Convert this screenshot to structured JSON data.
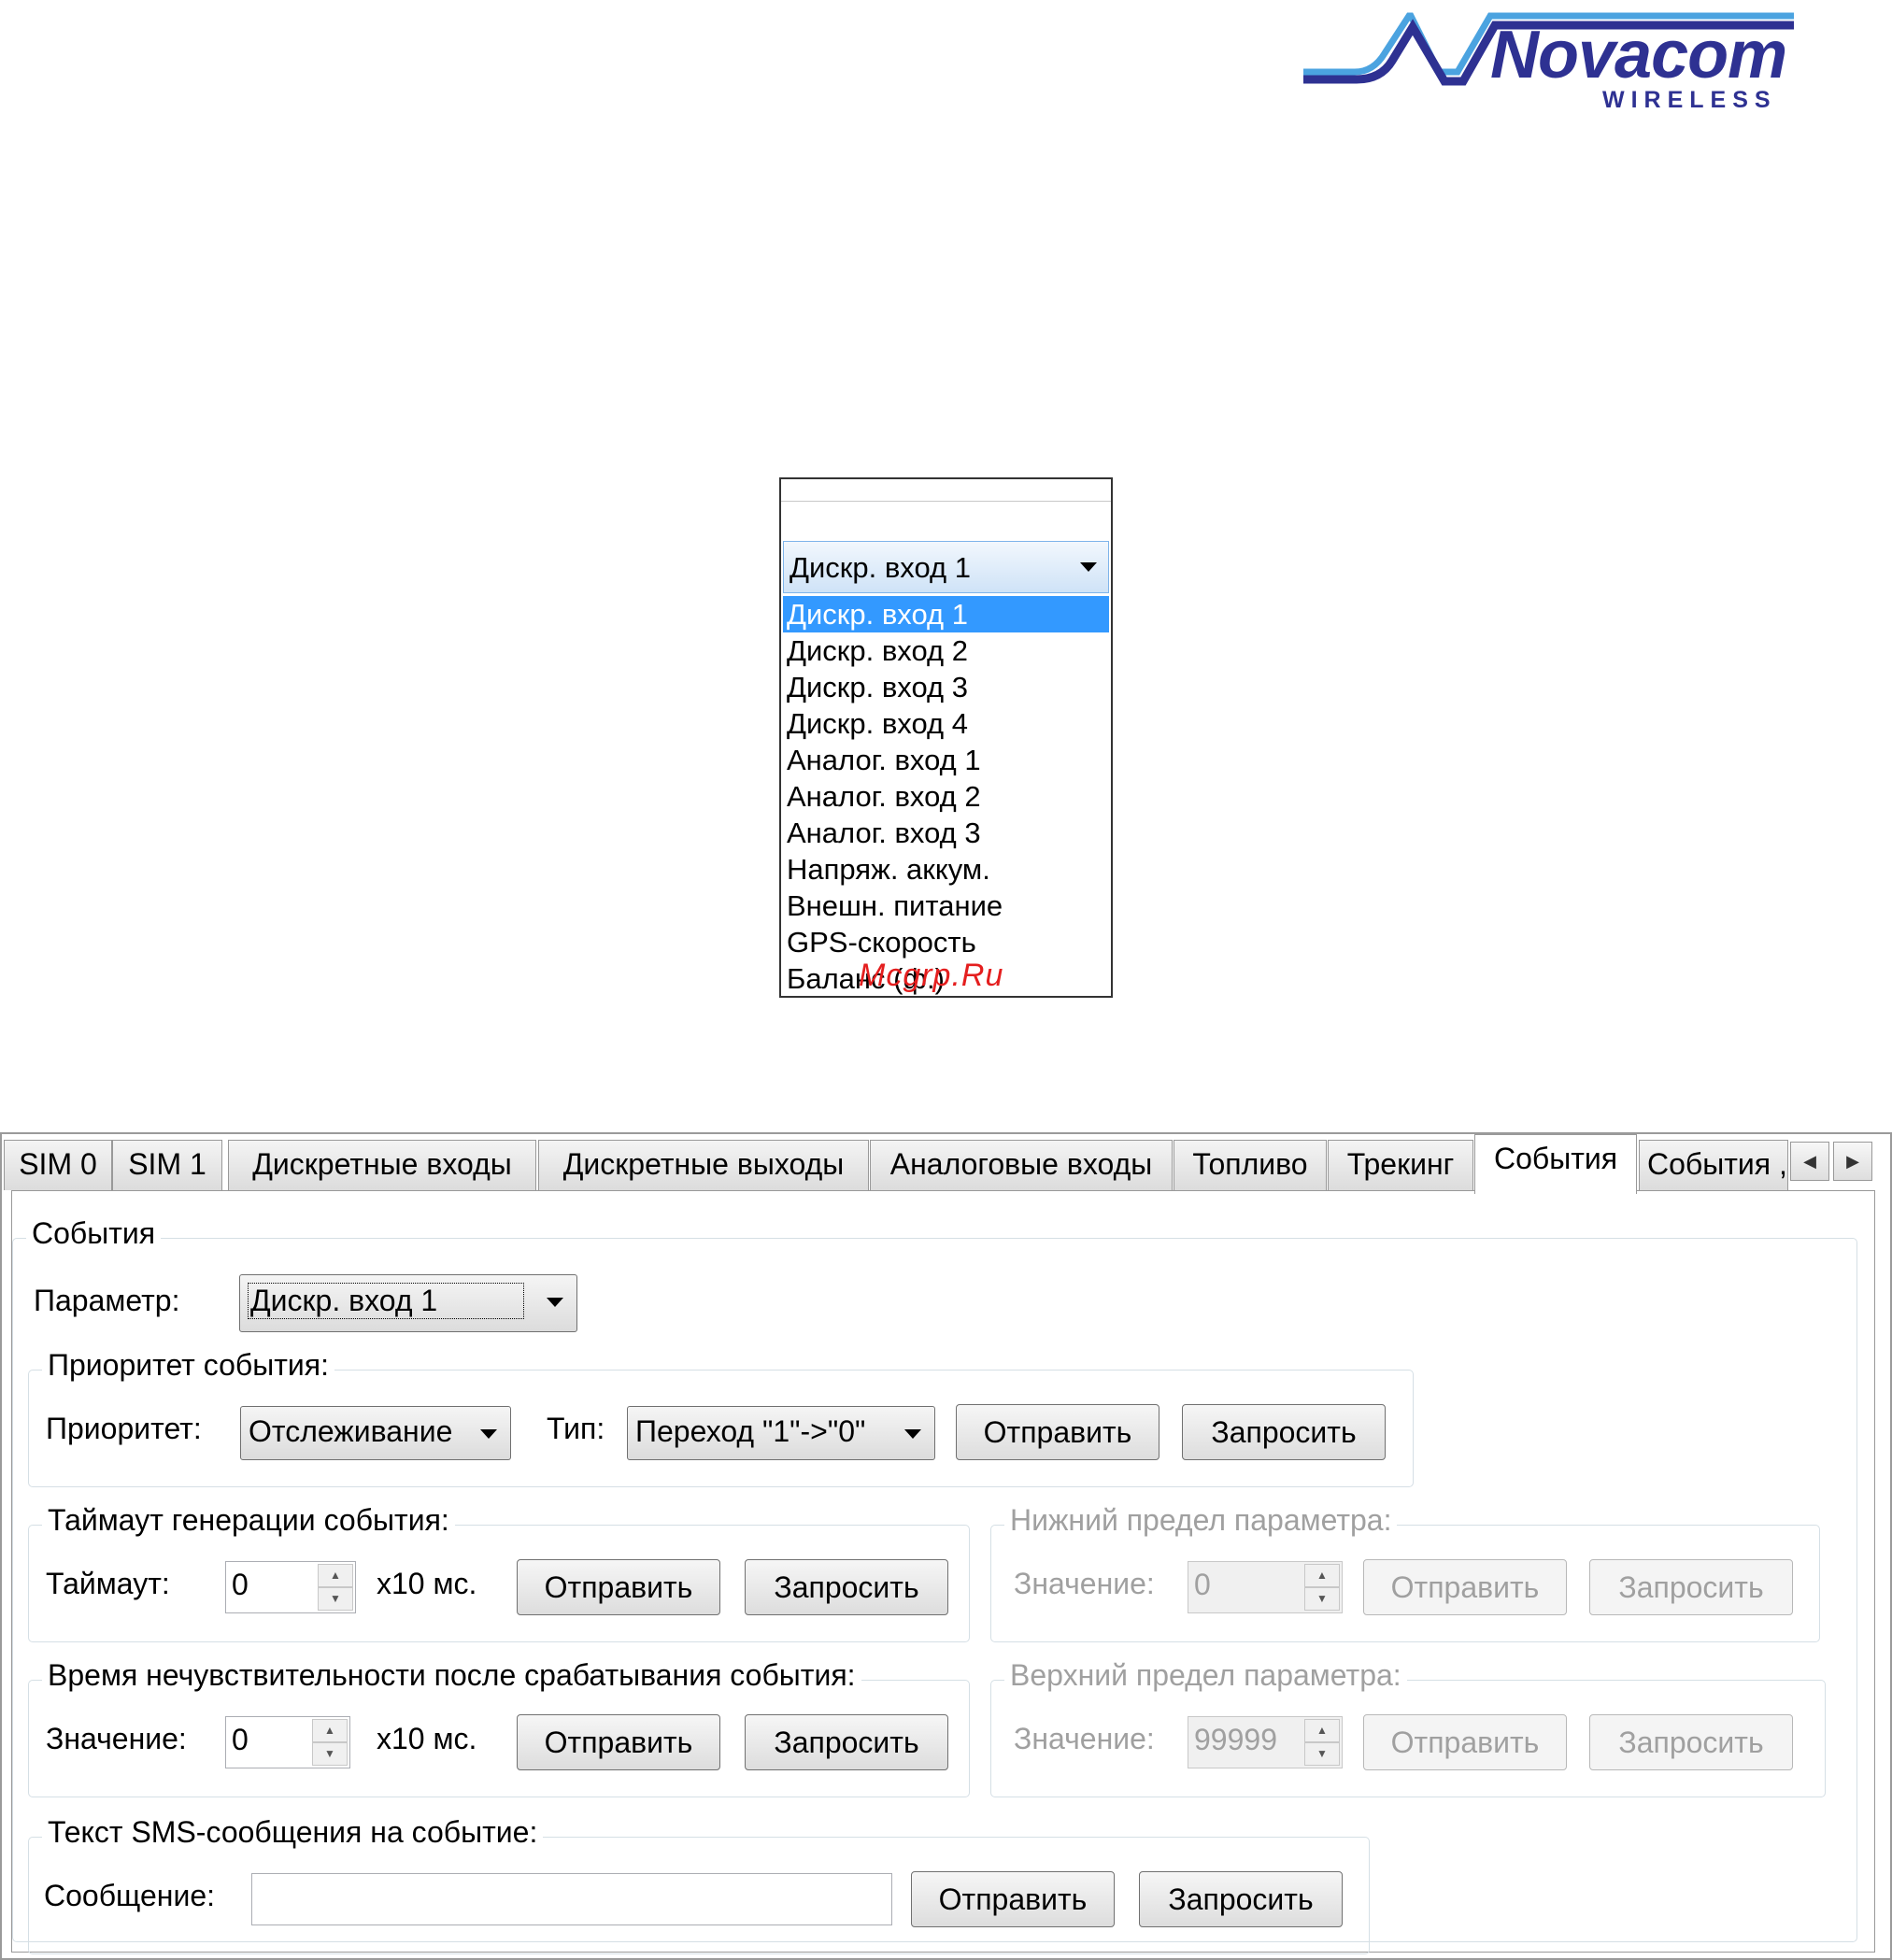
{
  "logo": {
    "name": "Novacom",
    "sub": "WIRELESS",
    "colors": {
      "brand": "#2e3192",
      "accent": "#4ba3e0"
    }
  },
  "dropdown_demo": {
    "selected": "Дискр. вход 1",
    "items": [
      "Дискр. вход 1",
      "Дискр. вход 2",
      "Дискр. вход 3",
      "Дискр. вход 4",
      "Аналог. вход 1",
      "Аналог. вход 2",
      "Аналог. вход 3",
      "Напряж. аккум.",
      "Внешн. питание",
      "GPS-скорость",
      "Баланс (ф.)"
    ],
    "highlight_color": "#3399ff"
  },
  "watermark": "Mcgrp.Ru",
  "tabs": [
    "SIM 0",
    "SIM 1",
    "Дискретные входы",
    "Дискретные выходы",
    "Аналоговые входы",
    "Топливо",
    "Трекинг",
    "События",
    "События ,"
  ],
  "active_tab": "События",
  "events": {
    "group_title": "События",
    "param_label": "Параметр:",
    "param_value": "Дискр. вход 1",
    "priority": {
      "title": "Приоритет события:",
      "priority_label": "Приоритет:",
      "priority_value": "Отслеживание",
      "type_label": "Тип:",
      "type_value": "Переход \"1\"->\"0\"",
      "send": "Отправить",
      "request": "Запросить"
    },
    "timeout": {
      "title": "Таймаут генерации события:",
      "label": "Таймаут:",
      "value": "0",
      "unit": "x10 мс.",
      "send": "Отправить",
      "request": "Запросить"
    },
    "lower": {
      "title": "Нижний предел параметра:",
      "label": "Значение:",
      "value": "0",
      "send": "Отправить",
      "request": "Запросить"
    },
    "insens": {
      "title": "Время нечувствительности после срабатывания события:",
      "label": "Значение:",
      "value": "0",
      "unit": "x10 мс.",
      "send": "Отправить",
      "request": "Запросить"
    },
    "upper": {
      "title": "Верхний предел параметра:",
      "label": "Значение:",
      "value": "99999",
      "send": "Отправить",
      "request": "Запросить"
    },
    "sms": {
      "title": "Текст SMS-сообщения на событие:",
      "label": "Сообщение:",
      "value": "",
      "send": "Отправить",
      "request": "Запросить"
    }
  }
}
